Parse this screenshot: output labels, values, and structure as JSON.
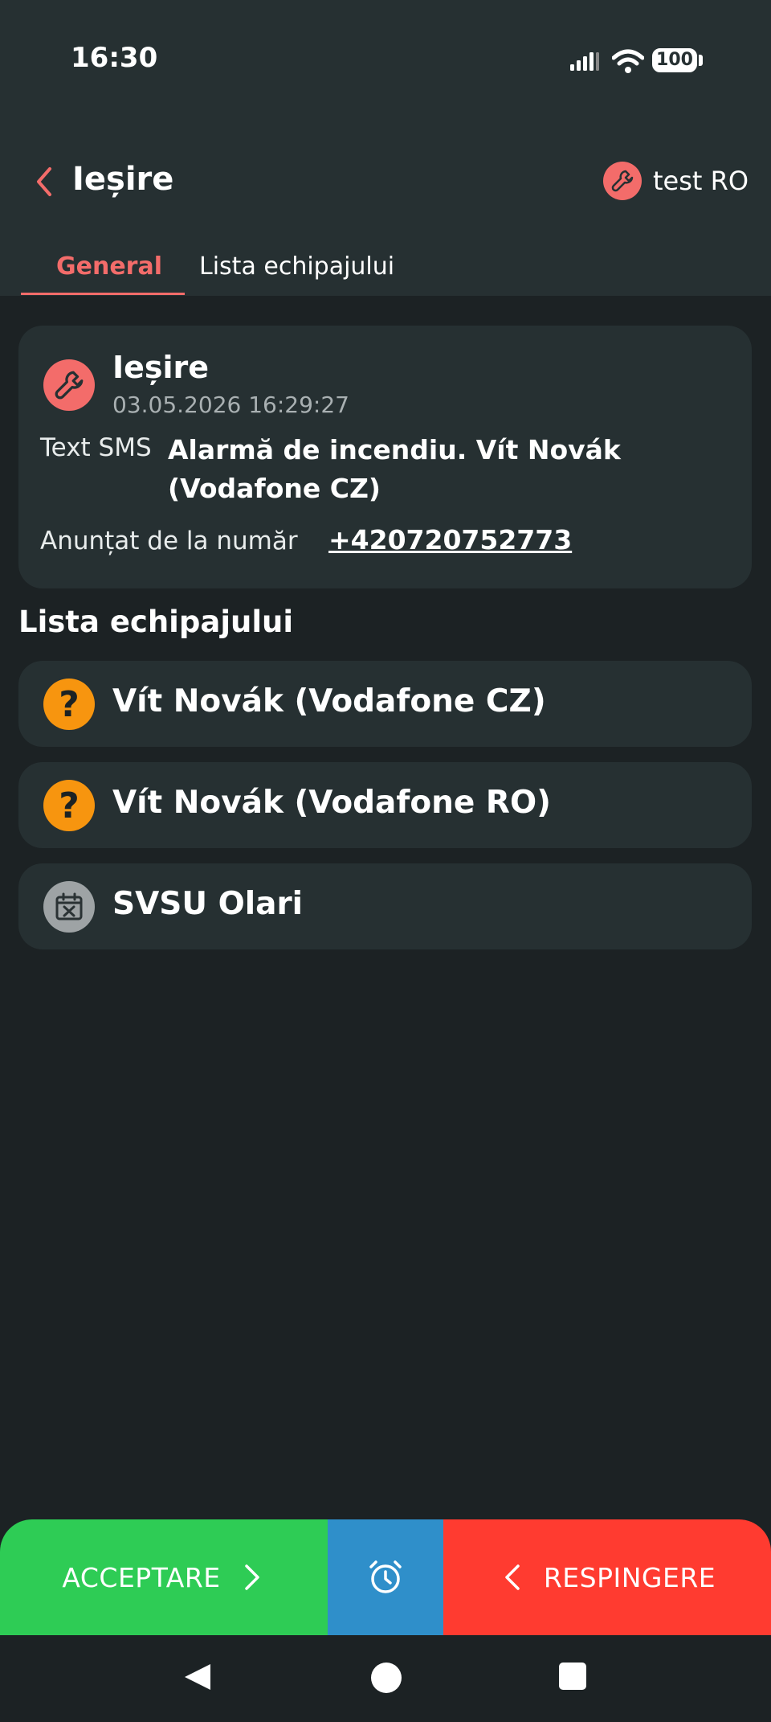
{
  "status_bar": {
    "time": "16:30",
    "battery": "100"
  },
  "header": {
    "title": "Ieșire",
    "account": "test RO"
  },
  "tabs": [
    {
      "label": "General",
      "active": true
    },
    {
      "label": "Lista echipajului",
      "active": false
    }
  ],
  "event": {
    "title": "Ieșire",
    "datetime": "03.05.2026 16:29:27",
    "sms_label": "Text SMS",
    "sms_text": "Alarmă de incendiu. Vít Novák (Vodafone CZ)",
    "from_label": "Anunțat de la număr",
    "from_number": "+420720752773",
    "icon": "wrench-icon"
  },
  "crew_section": {
    "title": "Lista echipajului",
    "items": [
      {
        "name": "Vít Novák (Vodafone CZ)",
        "status_icon": "question-icon",
        "status_color": "#f7950f"
      },
      {
        "name": "Vít Novák (Vodafone RO)",
        "status_icon": "question-icon",
        "status_color": "#f7950f"
      },
      {
        "name": "SVSU Olari",
        "status_icon": "calendar-x-icon",
        "status_color": "#9ea3a5"
      }
    ]
  },
  "actions": {
    "accept": "ACCEPTARE",
    "reject": "RESPINGERE",
    "snooze_icon": "alarm-clock-icon"
  },
  "colors": {
    "accent": "#f36c6a",
    "accept": "#2ecc55",
    "snooze": "#2f8fca",
    "reject": "#ff3b30",
    "card": "#263032",
    "background": "#1c2224"
  }
}
